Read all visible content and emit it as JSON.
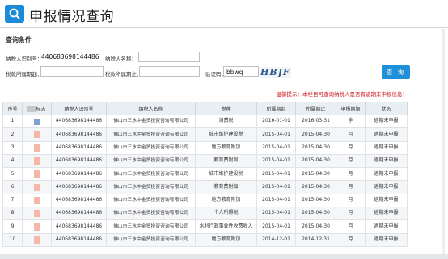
{
  "header": {
    "title": "申报情况查询",
    "icon": "magnifier-icon"
  },
  "conditions": {
    "section_label": "查询条件",
    "taxpayer_id_label": "纳税人识别号：",
    "taxpayer_id_value": "440683698144486",
    "taxpayer_name_label": "纳税人名称：",
    "taxpayer_name_value": "",
    "period_start_label": "税款所属期起：",
    "period_start_value": "",
    "period_end_label": "税款所属期止：",
    "period_end_value": "",
    "captcha_label": "验证码：",
    "captcha_value": "bbwq",
    "captcha_image_text": "HBJF",
    "query_button": "查 询"
  },
  "notice": "温馨提示：本栏目可查询纳税人是否有逾期未申报信息！",
  "table": {
    "columns": [
      "序号",
      "标志",
      "纳税人识别号",
      "纳税人名称",
      "税种",
      "所属期起",
      "所属期止",
      "申报期限",
      "状态"
    ],
    "rows": [
      {
        "no": "1",
        "tin": "440683698144486",
        "name": "佛山市三水中金贸投资咨询有限公司",
        "tax": "消费税",
        "start": "2016-01-01",
        "end": "2016-03-31",
        "term": "季",
        "status": "逾期未申报"
      },
      {
        "no": "2",
        "tin": "440683698144486",
        "name": "佛山市三水中金贸投资咨询有限公司",
        "tax": "城市维护建设税",
        "start": "2015-04-01",
        "end": "2015-04-30",
        "term": "月",
        "status": "逾期未申报"
      },
      {
        "no": "3",
        "tin": "440683698144486",
        "name": "佛山市三水中金贸投资咨询有限公司",
        "tax": "地方教育附加",
        "start": "2015-04-01",
        "end": "2015-04-30",
        "term": "月",
        "status": "逾期未申报"
      },
      {
        "no": "4",
        "tin": "440683698144486",
        "name": "佛山市三水中金贸投资咨询有限公司",
        "tax": "教育费附加",
        "start": "2015-04-01",
        "end": "2015-04-30",
        "term": "月",
        "status": "逾期未申报"
      },
      {
        "no": "5",
        "tin": "440683698144486",
        "name": "佛山市三水中金贸投资咨询有限公司",
        "tax": "城市维护建设税",
        "start": "2015-04-01",
        "end": "2015-04-30",
        "term": "月",
        "status": "逾期未申报"
      },
      {
        "no": "6",
        "tin": "440683698144486",
        "name": "佛山市三水中金贸投资咨询有限公司",
        "tax": "教育费附加",
        "start": "2015-04-01",
        "end": "2015-04-30",
        "term": "月",
        "status": "逾期未申报"
      },
      {
        "no": "7",
        "tin": "440683698144486",
        "name": "佛山市三水中金贸投资咨询有限公司",
        "tax": "地方教育附加",
        "start": "2015-04-01",
        "end": "2015-04-30",
        "term": "月",
        "status": "逾期未申报"
      },
      {
        "no": "8",
        "tin": "440683698144486",
        "name": "佛山市三水中金贸投资咨询有限公司",
        "tax": "个人所得税",
        "start": "2015-04-01",
        "end": "2015-04-30",
        "term": "月",
        "status": "逾期未申报"
      },
      {
        "no": "9",
        "tin": "440683698144486",
        "name": "佛山市三水中金贸投资咨询有限公司",
        "tax": "水利行政事业性收费收入",
        "start": "2015-04-01",
        "end": "2015-04-30",
        "term": "月",
        "status": "逾期未申报"
      },
      {
        "no": "10",
        "tin": "440683698144486",
        "name": "佛山市三水中金贸投资咨询有限公司",
        "tax": "地方教育附加",
        "start": "2014-12-01",
        "end": "2014-12-31",
        "term": "月",
        "status": "逾期未申报"
      }
    ]
  }
}
